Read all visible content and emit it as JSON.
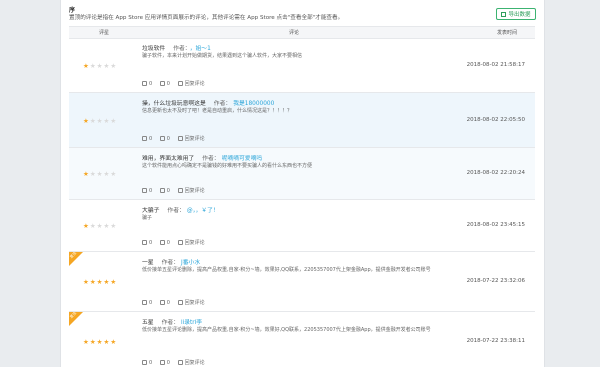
{
  "header": {
    "title": "序",
    "description": "置顶的评论是指在 App Store 应用详情页面展示的评论，其他评论需在 App Store 点击\"查看全部\"才能查看。",
    "export_label": "导出数据"
  },
  "table": {
    "columns": [
      "评星",
      "评论",
      "发表时间"
    ]
  },
  "reviews": [
    {
      "rating": 1,
      "title": "垃圾软件",
      "author_label": "作者：",
      "author": "，姐～1",
      "body": "骗子软件，本来计划开始做期货，结果遇到这个骗人软件，大家不要相信",
      "likes": "0",
      "dislikes": "0",
      "reply": "回复评论",
      "date": "2018-08-02 21:58:17",
      "highlight": false,
      "badge": ""
    },
    {
      "rating": 1,
      "title": "操，什么垃圾玩意啊这是",
      "author_label": "作者：",
      "author": "我是18000000",
      "body": "信息更新也太不及时了吧！老是自动重启，什么情况这是？！！！？",
      "likes": "0",
      "dislikes": "0",
      "reply": "回复评论",
      "date": "2018-08-02 22:05:50",
      "highlight": true,
      "badge": ""
    },
    {
      "rating": 1,
      "title": "难用，界面太难用了",
      "author_label": "作者：",
      "author": "呢嘀嘀可爱嘀吗",
      "body": "这个软件能用点心吗确定不是骗钱的好难用不要买骗人的看什么东西也不方便",
      "likes": "0",
      "dislikes": "0",
      "reply": "回复评论",
      "date": "2018-08-02 22:20:24",
      "highlight": true,
      "badge": ""
    },
    {
      "rating": 1,
      "title": "大骗子",
      "author_label": "作者：",
      "author": "@，，￥了！",
      "body": "骗子",
      "likes": "0",
      "dislikes": "0",
      "reply": "回复评论",
      "date": "2018-08-02 23:45:15",
      "highlight": false,
      "badge": ""
    },
    {
      "rating": 5,
      "title": "一星",
      "author_label": "作者：",
      "author": "J番小水",
      "body": "低价接单五星评论删除，提高产品权重,自家-积分~墙，效果好,QQ联系，2205357007代上架金融App，提供金融开发者公司账号",
      "likes": "0",
      "dislikes": "0",
      "reply": "回复评论",
      "date": "2018-07-22 23:32:06",
      "highlight": false,
      "badge": "置顶"
    },
    {
      "rating": 5,
      "title": "五星",
      "author_label": "作者：",
      "author": "li录trl李",
      "body": "低价接单五星评论删除，提高产品权重,自家-积分~墙，效果好,QQ联系，2205357007代上架金融App，提供金融开发者公司账号",
      "likes": "0",
      "dislikes": "0",
      "reply": "回复评论",
      "date": "2018-07-22 23:38:11",
      "highlight": false,
      "badge": "置顶"
    }
  ]
}
